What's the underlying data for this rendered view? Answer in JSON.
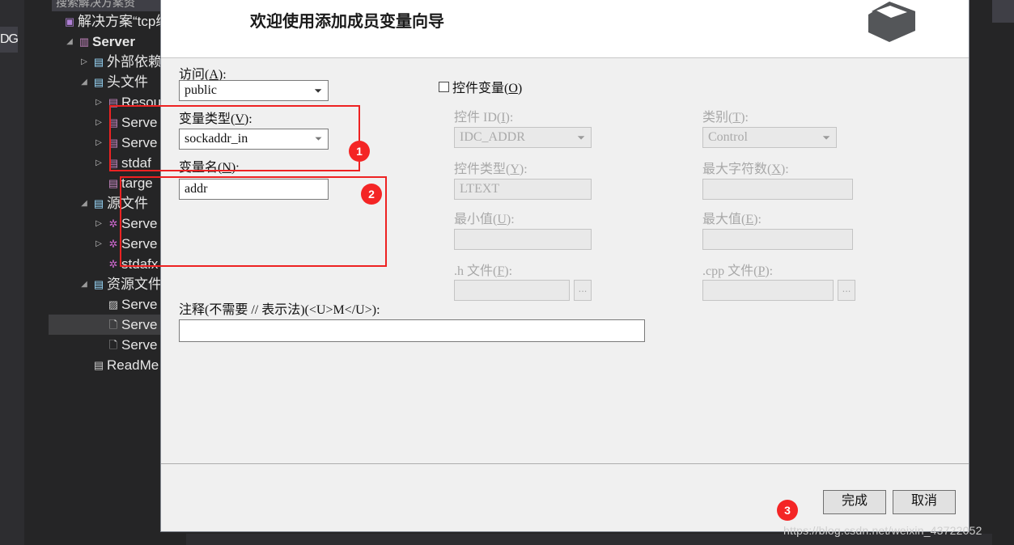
{
  "ide": {
    "tab_fragment": "DG",
    "search": {
      "placeholder": "搜索解决方案资",
      "icon": "search-icon"
    },
    "tree": [
      {
        "label": "解决方案“tcp编",
        "indent": 0,
        "arrow": "none",
        "icon": "solution-icon",
        "icon_class": "ic-sln",
        "glyph": "▣",
        "bold": false,
        "selected": false
      },
      {
        "label": "Server",
        "indent": 1,
        "arrow": "open",
        "icon": "project-icon",
        "icon_class": "ic-proj",
        "glyph": "▥",
        "bold": true,
        "selected": false
      },
      {
        "label": "外部依赖",
        "indent": 2,
        "arrow": "closed",
        "icon": "references-folder-icon",
        "icon_class": "ic-folder",
        "glyph": "▤",
        "bold": false,
        "selected": false
      },
      {
        "label": "头文件",
        "indent": 2,
        "arrow": "open",
        "icon": "folder-icon",
        "icon_class": "ic-folder",
        "glyph": "▤",
        "bold": false,
        "selected": false
      },
      {
        "label": "Resou",
        "indent": 3,
        "arrow": "closed",
        "icon": "header-file-icon",
        "icon_class": "ic-h",
        "glyph": "▤",
        "bold": false,
        "selected": false
      },
      {
        "label": "Serve",
        "indent": 3,
        "arrow": "closed",
        "icon": "header-file-icon",
        "icon_class": "ic-h",
        "glyph": "▤",
        "bold": false,
        "selected": false
      },
      {
        "label": "Serve",
        "indent": 3,
        "arrow": "closed",
        "icon": "header-file-icon",
        "icon_class": "ic-h",
        "glyph": "▤",
        "bold": false,
        "selected": false
      },
      {
        "label": "stdaf",
        "indent": 3,
        "arrow": "closed",
        "icon": "header-file-icon",
        "icon_class": "ic-h",
        "glyph": "▤",
        "bold": false,
        "selected": false
      },
      {
        "label": "targe",
        "indent": 3,
        "arrow": "none",
        "icon": "header-file-icon",
        "icon_class": "ic-h",
        "glyph": "▤",
        "bold": false,
        "selected": false
      },
      {
        "label": "源文件",
        "indent": 2,
        "arrow": "open",
        "icon": "folder-icon",
        "icon_class": "ic-folder",
        "glyph": "▤",
        "bold": false,
        "selected": false
      },
      {
        "label": "Serve",
        "indent": 3,
        "arrow": "closed",
        "icon": "cpp-file-icon",
        "icon_class": "ic-cpp",
        "glyph": "✲",
        "bold": false,
        "selected": false
      },
      {
        "label": "Serve",
        "indent": 3,
        "arrow": "closed",
        "icon": "cpp-file-icon",
        "icon_class": "ic-cpp",
        "glyph": "✲",
        "bold": false,
        "selected": false
      },
      {
        "label": "stdafx",
        "indent": 3,
        "arrow": "none",
        "icon": "cpp-file-icon",
        "icon_class": "ic-cpp",
        "glyph": "✲",
        "bold": false,
        "selected": false
      },
      {
        "label": "资源文件",
        "indent": 2,
        "arrow": "open",
        "icon": "folder-icon",
        "icon_class": "ic-folder",
        "glyph": "▤",
        "bold": false,
        "selected": false
      },
      {
        "label": "Serve",
        "indent": 3,
        "arrow": "none",
        "icon": "image-file-icon",
        "icon_class": "ic-img",
        "glyph": "▨",
        "bold": false,
        "selected": false
      },
      {
        "label": "Serve",
        "indent": 3,
        "arrow": "none",
        "icon": "resource-file-icon",
        "icon_class": "ic-rc",
        "glyph": "🗋",
        "bold": false,
        "selected": true
      },
      {
        "label": "Serve",
        "indent": 3,
        "arrow": "none",
        "icon": "resource-file-icon",
        "icon_class": "ic-rc",
        "glyph": "🗋",
        "bold": false,
        "selected": false
      },
      {
        "label": "ReadMe",
        "indent": 2,
        "arrow": "none",
        "icon": "text-file-icon",
        "icon_class": "ic-file",
        "glyph": "▤",
        "bold": false,
        "selected": false
      }
    ],
    "bottom_hint": ""
  },
  "dialog": {
    "title": "欢迎使用添加成员变量向导",
    "logo_icon": "box-3d-icon",
    "left_column": {
      "access": {
        "label_pre": "访问(",
        "label_key": "A",
        "label_post": "):",
        "value": "public",
        "icon": "chevron-down-icon"
      },
      "variable_type": {
        "label_pre": "变量类型(",
        "label_key": "V",
        "label_post": "):",
        "value": "sockaddr_in",
        "icon": "chevron-down-icon"
      },
      "variable_name": {
        "label_pre": "变量名(",
        "label_key": "N",
        "label_post": "):",
        "value": "addr"
      }
    },
    "control_variable": {
      "checkbox_label_pre": "控件变量(",
      "checkbox_label_key": "O",
      "checkbox_label_post": ")",
      "checked": false,
      "control_id": {
        "label_pre": "控件 ID(",
        "label_key": "I",
        "label_post": "):",
        "value": "IDC_ADDR",
        "icon": "chevron-down-icon"
      },
      "control_type": {
        "label_pre": "控件类型(",
        "label_key": "Y",
        "label_post": "):",
        "value": "LTEXT"
      },
      "min_value": {
        "label_pre": "最小值(",
        "label_key": "U",
        "label_post": "):",
        "value": ""
      },
      "h_file": {
        "label_pre": ".h 文件(",
        "label_key": "F",
        "label_post": "):",
        "value": "",
        "browse": "..."
      },
      "category": {
        "label_pre": "类别(",
        "label_key": "T",
        "label_post": "):",
        "value": "Control",
        "icon": "chevron-down-icon"
      },
      "max_chars": {
        "label_pre": "最大字符数(",
        "label_key": "X",
        "label_post": "):",
        "value": ""
      },
      "max_value": {
        "label_pre": "最大值(",
        "label_key": "E",
        "label_post": "):",
        "value": ""
      },
      "cpp_file": {
        "label_pre": ".cpp 文件(",
        "label_key": "P",
        "label_post": "):",
        "value": "",
        "browse": "..."
      }
    },
    "comment": {
      "label": "注释(不需要 // 表示法)(<U>M</U>):",
      "value": ""
    },
    "footer": {
      "finish_label": "完成",
      "cancel_label": "取消"
    }
  },
  "annotations": {
    "badges": [
      {
        "num": "1"
      },
      {
        "num": "2"
      },
      {
        "num": "3"
      }
    ],
    "color": "#f42525"
  },
  "watermark": {
    "text": "https://blog.csdn.net/weixin_43722052"
  }
}
